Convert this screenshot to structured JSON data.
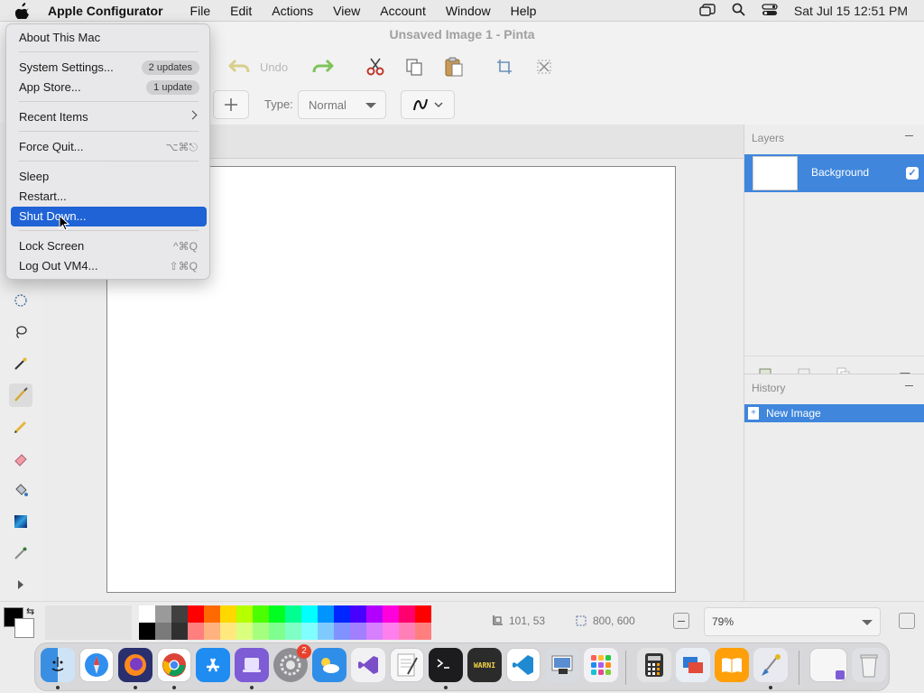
{
  "menubar": {
    "app_name": "Apple Configurator",
    "menus": [
      "File",
      "Edit",
      "Actions",
      "View",
      "Account",
      "Window",
      "Help"
    ],
    "clock": "Sat Jul 15  12:51 PM"
  },
  "window": {
    "title": "Unsaved Image 1 - Pinta",
    "toolbar": {
      "undo_label": "Undo"
    },
    "type_label": "Type:",
    "type_value": "Normal"
  },
  "apple_menu": {
    "about": "About This Mac",
    "system_settings": "System Settings...",
    "system_settings_badge": "2 updates",
    "app_store": "App Store...",
    "app_store_badge": "1 update",
    "recent_items": "Recent Items",
    "force_quit": "Force Quit...",
    "force_quit_shortcut": "⌥⌘⎋",
    "sleep": "Sleep",
    "restart": "Restart...",
    "shut_down": "Shut Down...",
    "lock_screen": "Lock Screen",
    "lock_screen_shortcut": "^⌘Q",
    "log_out": "Log Out VM4...",
    "log_out_shortcut": "⇧⌘Q"
  },
  "layers": {
    "title": "Layers",
    "items": [
      {
        "name": "Background",
        "visible": true
      }
    ]
  },
  "history": {
    "title": "History",
    "items": [
      "New Image"
    ]
  },
  "status": {
    "cursor_pos": "101, 53",
    "image_size": "800, 600",
    "zoom": "79%"
  },
  "palette": {
    "top": [
      "#ffffff",
      "#9a9a9a",
      "#404040",
      "#ff0000",
      "#ff6a00",
      "#ffd800",
      "#b6ff00",
      "#4cff00",
      "#00ff21",
      "#00ff90",
      "#00ffff",
      "#0094ff",
      "#0026ff",
      "#4800ff",
      "#b200ff",
      "#ff00dc",
      "#ff006e",
      "#ff0000"
    ],
    "bottom": [
      "#000000",
      "#7a7a7a",
      "#303030",
      "#ff7f7f",
      "#ffb27f",
      "#ffe97f",
      "#daff7f",
      "#a5ff7f",
      "#7fff8e",
      "#7fffc5",
      "#7fffff",
      "#7fc9ff",
      "#7f92ff",
      "#a17fff",
      "#d67fff",
      "#ff7fed",
      "#ff7fb6",
      "#ff7f7f"
    ]
  },
  "dock": {
    "badge_count": "2",
    "warning_text": "WARNI"
  },
  "colors": {
    "accent": "#3f86dc",
    "menu_highlight": "#1f63d6"
  }
}
